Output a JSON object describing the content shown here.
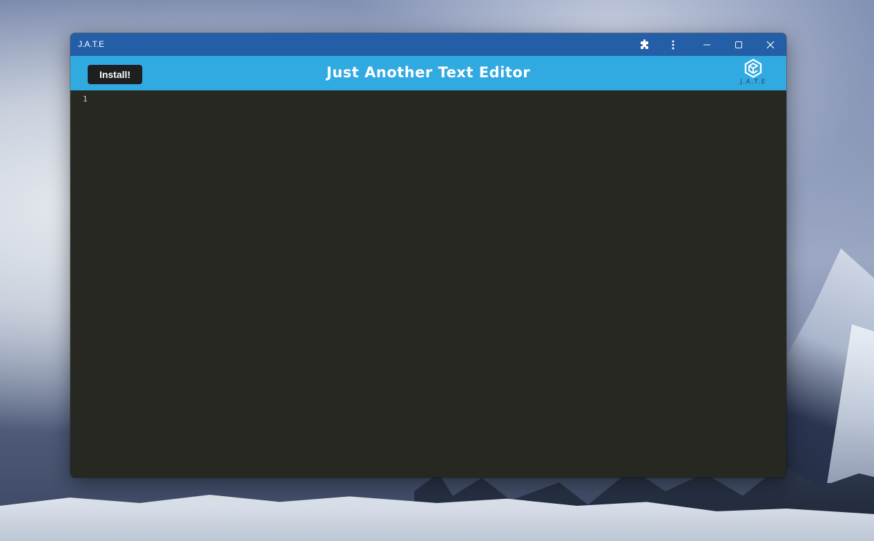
{
  "window": {
    "title": "J.A.T.E",
    "controls": {
      "extensions_icon": "puzzle-icon",
      "menu_icon": "kebab-menu-icon",
      "minimize_icon": "minimize-icon",
      "maximize_icon": "maximize-icon",
      "close_icon": "close-icon"
    },
    "titlebar_color": "#235ea6"
  },
  "header": {
    "install_label": "Install!",
    "app_title": "Just Another Text Editor",
    "logo_text": "J.A.T.E",
    "background_color": "#31a9e1"
  },
  "editor": {
    "line_numbers": [
      "1"
    ],
    "content": "",
    "background_color": "#272822"
  }
}
